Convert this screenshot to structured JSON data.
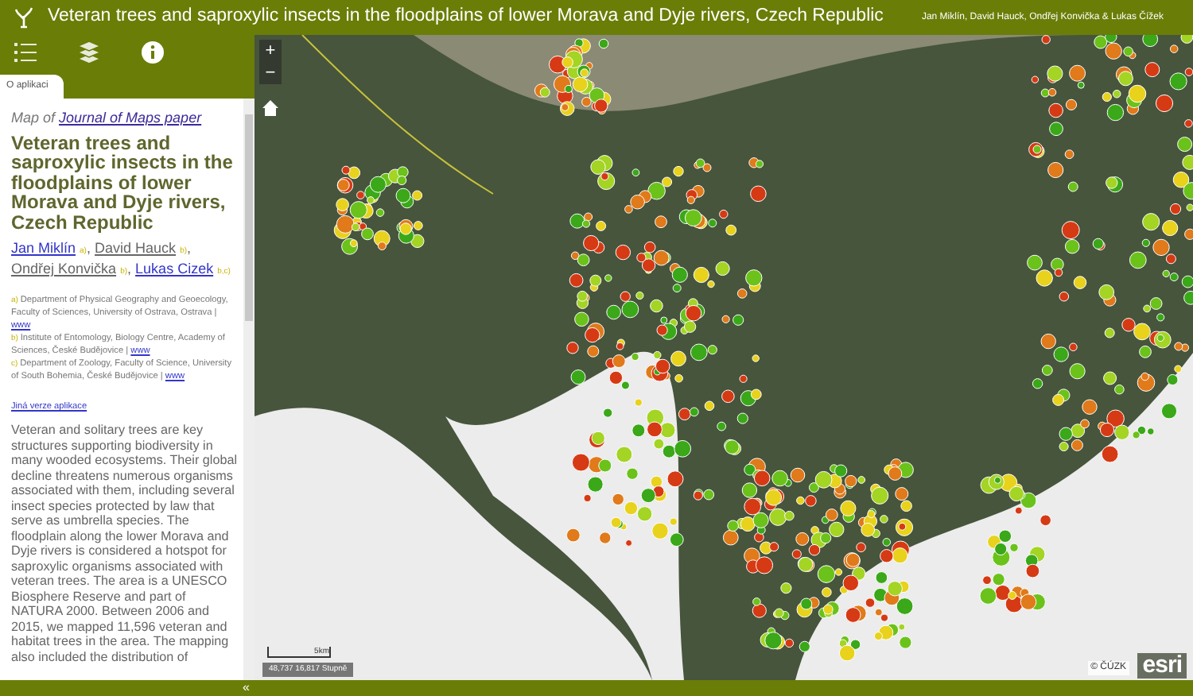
{
  "header": {
    "title": "Veteran trees and saproxylic insects in the floodplains of lower Morava and Dyje rivers, Czech Republic",
    "authors": "Jan Miklín, David Hauck, Ondřej Konvička & Lukas Čížek"
  },
  "toolbar": {
    "buttons": [
      {
        "kind": "legend",
        "selected": false
      },
      {
        "kind": "layers",
        "selected": false
      },
      {
        "kind": "info",
        "selected": true
      }
    ]
  },
  "panel": {
    "tabs": [
      {
        "label": "O aplikaci",
        "selected": true
      }
    ],
    "map_of": "Map of",
    "paper_link": "Journal of Maps paper",
    "title": "Veteran trees and saproxylic insects in the floodplains of lower Morava and Dyje rivers, Czech Republic",
    "authors": [
      {
        "name": "Jan Miklín",
        "link": true,
        "mark": "a)",
        "separator": ","
      },
      {
        "name": "David Hauck",
        "link": false,
        "mark": "b)",
        "separator": ","
      },
      {
        "name": "Ondřej Konvička",
        "link": false,
        "mark": "b)",
        "separator": ","
      },
      {
        "name": "Lukas Cizek",
        "link": true,
        "mark": "b,c)"
      }
    ],
    "affiliations": [
      {
        "mark": "a)",
        "text": "Department of Physical Geography and Geoecology, Faculty of Sciences, University of Ostrava, Ostrava |",
        "link": "www"
      },
      {
        "mark": "b)",
        "text": "Institute of Entomology, Biology Centre, Academy of Sciences, České Budějovice |",
        "link": "www"
      },
      {
        "mark": "c)",
        "text": "Department of Zoology, Faculty of Science, University of South Bohemia, České Budějovice |",
        "link": "www"
      }
    ],
    "version_link": "Jiná verze aplikace",
    "abstract": "Veteran and solitary trees are key structures supporting biodiversity in many wooded ecosystems. Their global decline threatens numerous organisms associated with them, including several insect species protected by law that serve as umbrella species. The floodplain along the lower Morava and Dyje rivers is considered a hotspot for saproxylic organisms associated with veteran trees. The area is a UNESCO Biosphere Reserve and part of NATURA 2000. Between 2006 and 2015, we mapped 11,596 veteran and habitat trees in the area. The mapping also included the distribution of",
    "collapse": "«"
  },
  "map": {
    "zoom_in": "+",
    "zoom_out": "−",
    "scale": "5km",
    "coordinates": "48,737 16,817 Stupně",
    "attribution": "© ČÚZK",
    "logo": "esri"
  }
}
